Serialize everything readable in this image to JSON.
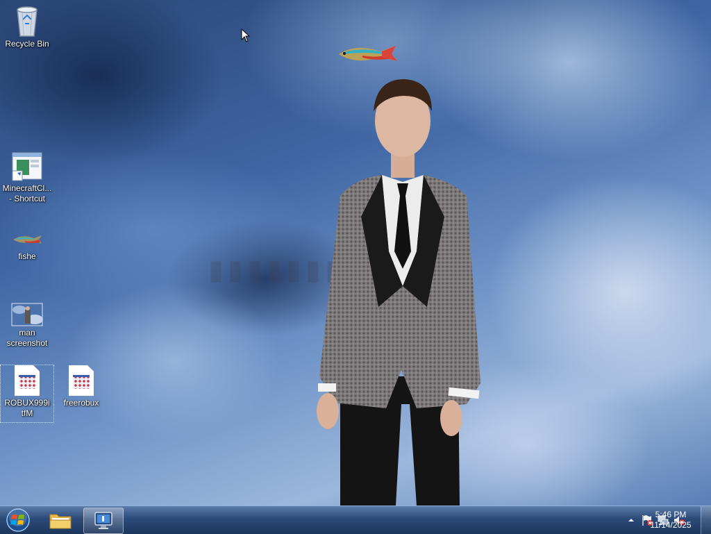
{
  "desktop": {
    "icons": [
      {
        "label": "Recycle Bin",
        "icon": "recycle-bin-icon"
      },
      {
        "label": "MinecraftCl... - Shortcut",
        "icon": "minecraft-client-shortcut-icon"
      },
      {
        "label": "fishe",
        "icon": "fish-icon"
      },
      {
        "label": "man screenshot",
        "icon": "image-file-icon"
      },
      {
        "label": "ROBUX999itfM",
        "icon": "web-document-icon"
      },
      {
        "label": "freerobux",
        "icon": "web-document-icon"
      }
    ],
    "selected_icon": "ROBUX999itfM"
  },
  "taskbar": {
    "start": "start-orb-icon",
    "pinned": [
      {
        "name": "Windows Explorer",
        "icon": "folder-icon"
      },
      {
        "name": "Remote Desktop",
        "icon": "monitor-icon",
        "active": true
      }
    ],
    "tray": {
      "show_hidden": "chevron-up-icon",
      "icons": [
        "action-center-flag-icon",
        "network-icon",
        "volume-muted-icon"
      ]
    },
    "clock": {
      "time": "5:46 PM",
      "date": "11/14/2025"
    }
  },
  "colors": {
    "taskbar_top": "#5a7aa8",
    "taskbar_bottom": "#1c365c",
    "sky_dark": "#2a4675",
    "sky_light": "#9cb7dc"
  }
}
